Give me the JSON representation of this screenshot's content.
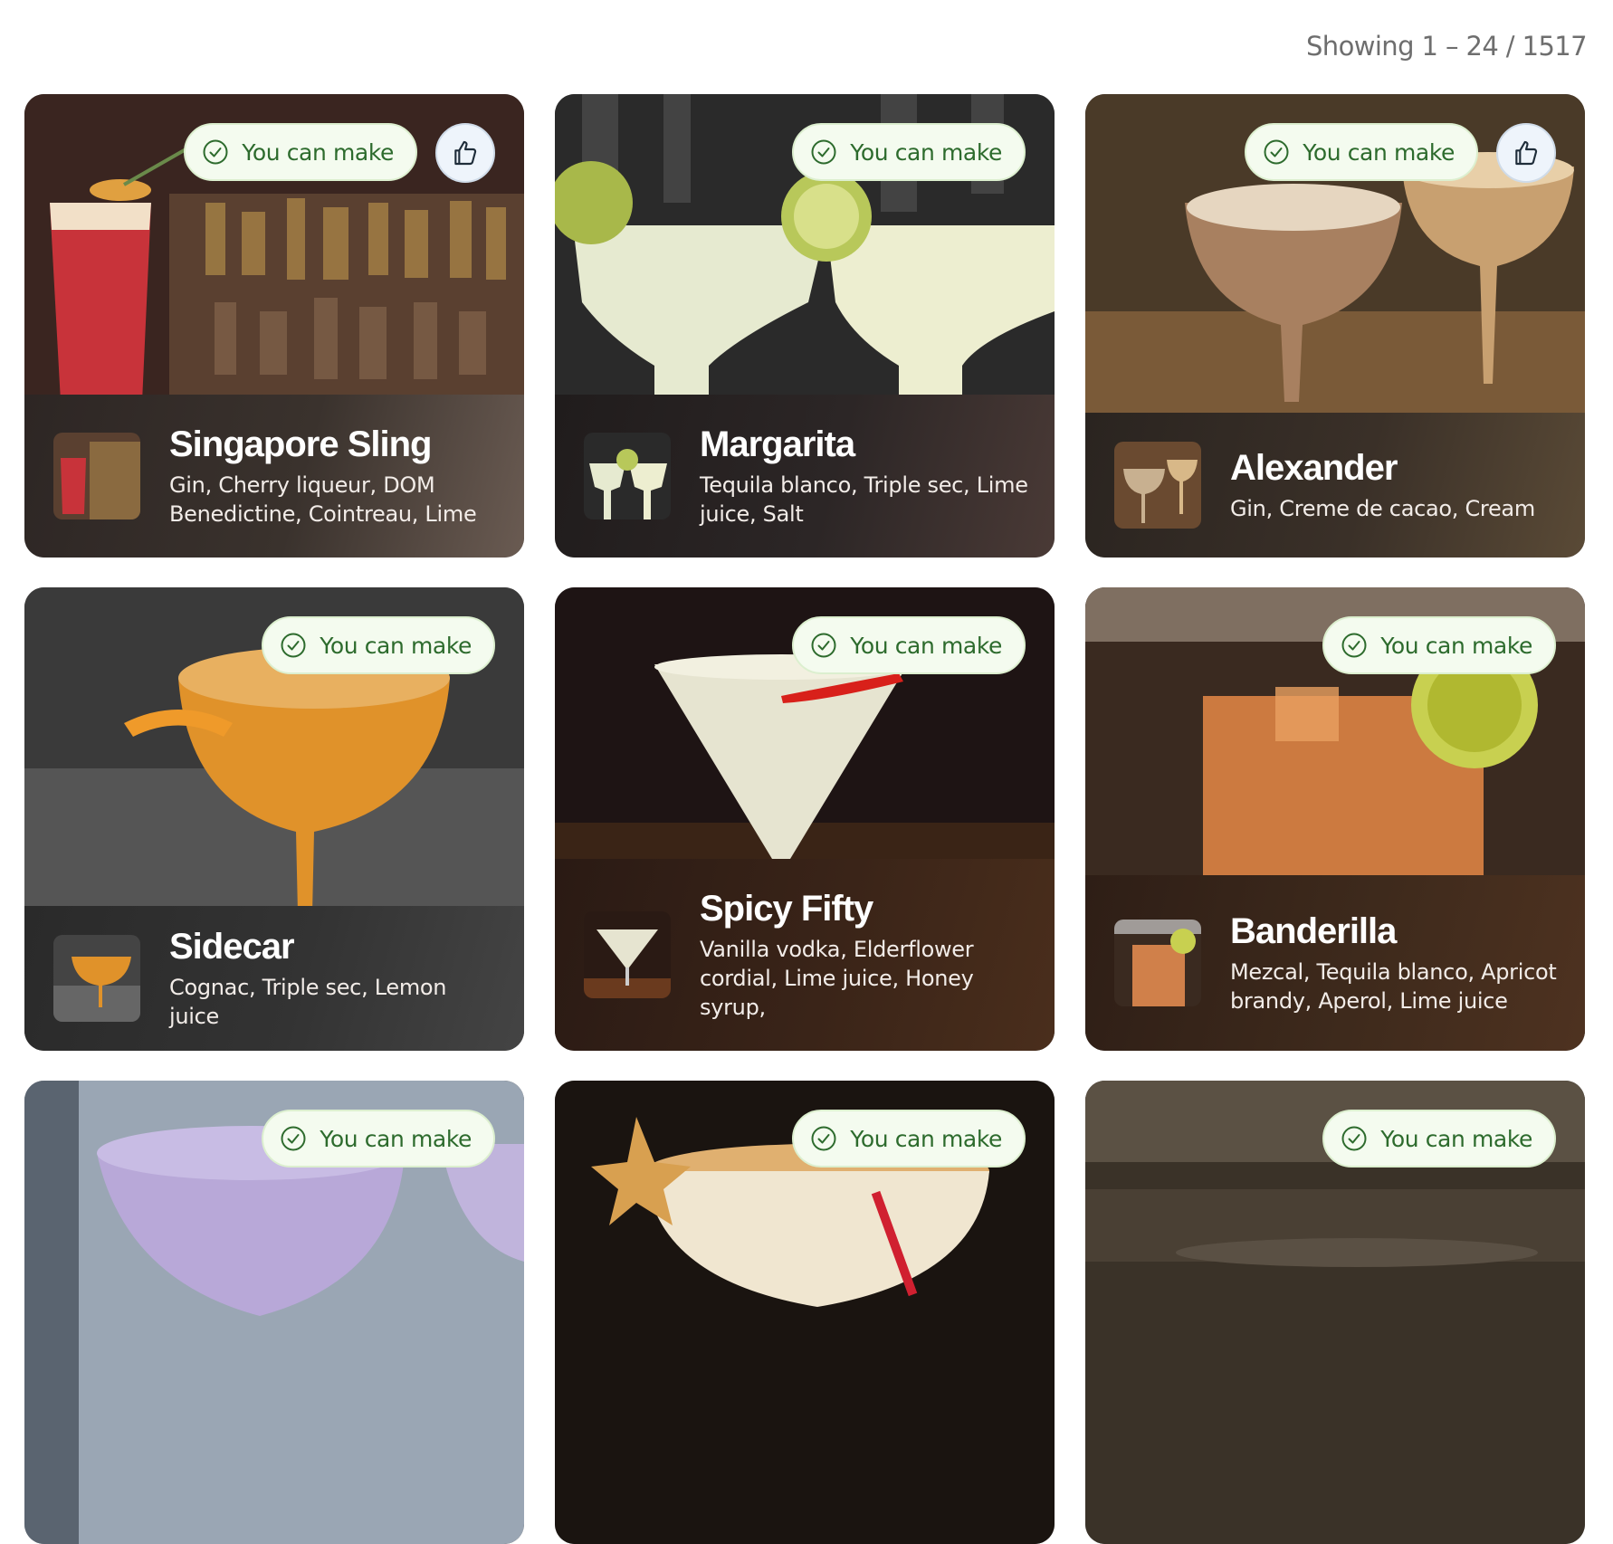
{
  "results": {
    "showing": "Showing 1 – 24 / 1517"
  },
  "status_color": "#2d6b2d",
  "cards": [
    {
      "title": "Singapore Sling",
      "ingredients": "Gin, Cherry liqueur, DOM Benedictine, Cointreau, Lime",
      "badge": "You can make",
      "liked_button": true
    },
    {
      "title": "Margarita",
      "ingredients": "Tequila blanco, Triple sec, Lime juice, Salt",
      "badge": "You can make",
      "liked_button": false
    },
    {
      "title": "Alexander",
      "ingredients": "Gin, Creme de cacao, Cream",
      "badge": "You can make",
      "liked_button": true
    },
    {
      "title": "Sidecar",
      "ingredients": "Cognac, Triple sec, Lemon juice",
      "badge": "You can make",
      "liked_button": false
    },
    {
      "title": "Spicy Fifty",
      "ingredients": "Vanilla vodka, Elderflower cordial, Lime juice, Honey syrup,",
      "badge": "You can make",
      "liked_button": false
    },
    {
      "title": "Banderilla",
      "ingredients": "Mezcal, Tequila blanco, Apricot brandy, Aperol, Lime juice",
      "badge": "You can make",
      "liked_button": false
    },
    {
      "title": "",
      "ingredients": "",
      "badge": "You can make",
      "liked_button": false
    },
    {
      "title": "",
      "ingredients": "",
      "badge": "You can make",
      "liked_button": false
    },
    {
      "title": "",
      "ingredients": "",
      "badge": "You can make",
      "liked_button": false
    }
  ]
}
